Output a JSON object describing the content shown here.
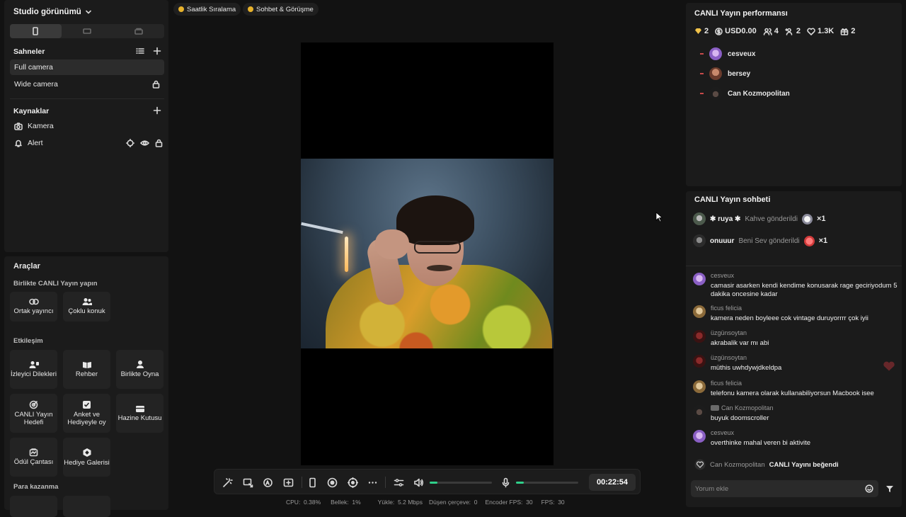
{
  "left": {
    "studio_title": "Studio görünümü",
    "scenes_label": "Sahneler",
    "scenes": [
      {
        "label": "Full camera",
        "active": true
      },
      {
        "label": "Wide camera",
        "active": false
      }
    ],
    "sources_label": "Kaynaklar",
    "sources": [
      {
        "label": "Kamera",
        "icon": "camera-icon"
      },
      {
        "label": "Alert",
        "icon": "bell-icon"
      }
    ]
  },
  "tools": {
    "title": "Araçlar",
    "group1": "Birlikte CANLI Yayın yapın",
    "group1_items": [
      "Ortak yayıncı",
      "Çoklu konuk"
    ],
    "group2": "Etkileşim",
    "group2_items": [
      "İzleyici Dilekleri",
      "Rehber",
      "Birlikte Oyna",
      "CANLI Yayın Hedefi",
      "Anket ve Hediyeyle oy",
      "Hazine Kutusu",
      "Ödül Çantası",
      "Hediye Galerisi"
    ],
    "group3": "Para kazanma"
  },
  "tags": [
    "Saatlik Sıralama",
    "Sohbet & Görüşme"
  ],
  "controls": {
    "timer": "00:22:54",
    "volume_level": 0.12,
    "mic_level": 0.12
  },
  "stats": {
    "cpu": "CPU:  0.38%",
    "memory": "Bellek:  1%",
    "upload": "Yükle:  5.2 Mbps",
    "dropped": "Düşen çerçeve:  0",
    "encoder_fps": "Encoder FPS:  30",
    "fps": "FPS:  30"
  },
  "performance": {
    "title": "CANLI Yayın performansı",
    "stats": [
      {
        "icon": "diamond-icon",
        "value": "2"
      },
      {
        "icon": "dollar-icon",
        "value": "USD0.00"
      },
      {
        "icon": "users-icon",
        "value": "4"
      },
      {
        "icon": "user-plus-icon",
        "value": "2"
      },
      {
        "icon": "heart-icon",
        "value": "1.3K"
      },
      {
        "icon": "gift-icon",
        "value": "2"
      }
    ],
    "viewers": [
      "cesveux",
      "bersey",
      "Can Kozmopolitan"
    ]
  },
  "chat": {
    "title": "CANLI Yayın sohbeti",
    "gifts": [
      {
        "user": "✱ ruya ✱",
        "action": "Kahve gönderildi",
        "count": "×1"
      },
      {
        "user": "onuuur",
        "action": "Beni Sev gönderildi",
        "count": "×1"
      }
    ],
    "messages": [
      {
        "name": "cesveux",
        "text": "camasir asarken kendi kendime konusarak rage geciriyodum 5 dakika oncesine kadar"
      },
      {
        "name": "ficus felicia",
        "text": "kamera neden boyleee cok vintage duruyorrrr çok iyii"
      },
      {
        "name": "üzgünsoytan",
        "text": "akrabalik var mı abi"
      },
      {
        "name": "üzgünsoytan",
        "text": "müthis uwhdywjdkeldpa"
      },
      {
        "name": "ficus felicia",
        "text": "telefonu kamera olarak kullanabiliyorsun Macbook isee"
      },
      {
        "name": "Can Kozmopolitan",
        "text": "buyuk doomscroller"
      },
      {
        "name": "cesveux",
        "text": "overthinke mahal veren bi aktivite"
      }
    ],
    "like_name": "Can Kozmopolitan",
    "like_text": "CANLI Yayını beğendi",
    "input_placeholder": "Yorum ekle"
  },
  "colors": {
    "accent_green": "#2fd08a",
    "background": "#121212",
    "panel": "#1b1b1b"
  }
}
